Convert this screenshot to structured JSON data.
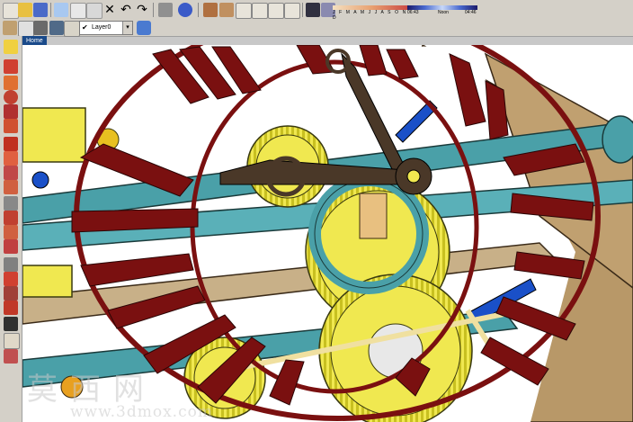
{
  "toolbar": {
    "layer_value": "Layer0",
    "months": "J F M A M J J A S O N D",
    "time_start": "06:43",
    "time_noon": "Noon",
    "time_end": "04:46"
  },
  "scene": {
    "tab_label": "Home"
  },
  "watermark": {
    "text": "莫西网",
    "url": "www.3dmox.com"
  },
  "icons": {
    "toolbar": [
      "new-icon",
      "open-icon",
      "save-icon",
      "cut-icon",
      "copy-icon",
      "paste-icon",
      "erase-icon",
      "undo-icon",
      "redo-icon",
      "print-icon",
      "model-info-icon",
      "camera-icon",
      "iso-view-icon",
      "top-view-icon",
      "front-view-icon",
      "right-view-icon",
      "back-view-icon",
      "left-view-icon",
      "shadow-toggle-icon",
      "fog-icon"
    ],
    "sidebar": [
      "select-icon",
      "paint-icon",
      "line-icon",
      "arc-icon",
      "rectangle-icon",
      "circle-icon",
      "polygon-icon",
      "freehand-icon",
      "push-pull-icon",
      "move-icon",
      "rotate-icon",
      "follow-me-icon",
      "scale-icon",
      "offset-icon",
      "tape-icon",
      "dimension-icon",
      "protractor-icon",
      "text-icon",
      "axes-icon",
      "3d-text-icon",
      "orbit-icon",
      "pan-icon",
      "zoom-icon",
      "zoom-window-icon",
      "zoom-extents-icon",
      "previous-icon",
      "walk-icon",
      "look-around-icon",
      "section-icon"
    ]
  },
  "colors": {
    "clock_ring": "#7a1010",
    "gear_yellow": "#f0e850",
    "frame_teal": "#4aa0a8",
    "plate_brown": "#b09060",
    "hand_dark": "#4a3828",
    "accent_blue": "#1a50c8"
  }
}
